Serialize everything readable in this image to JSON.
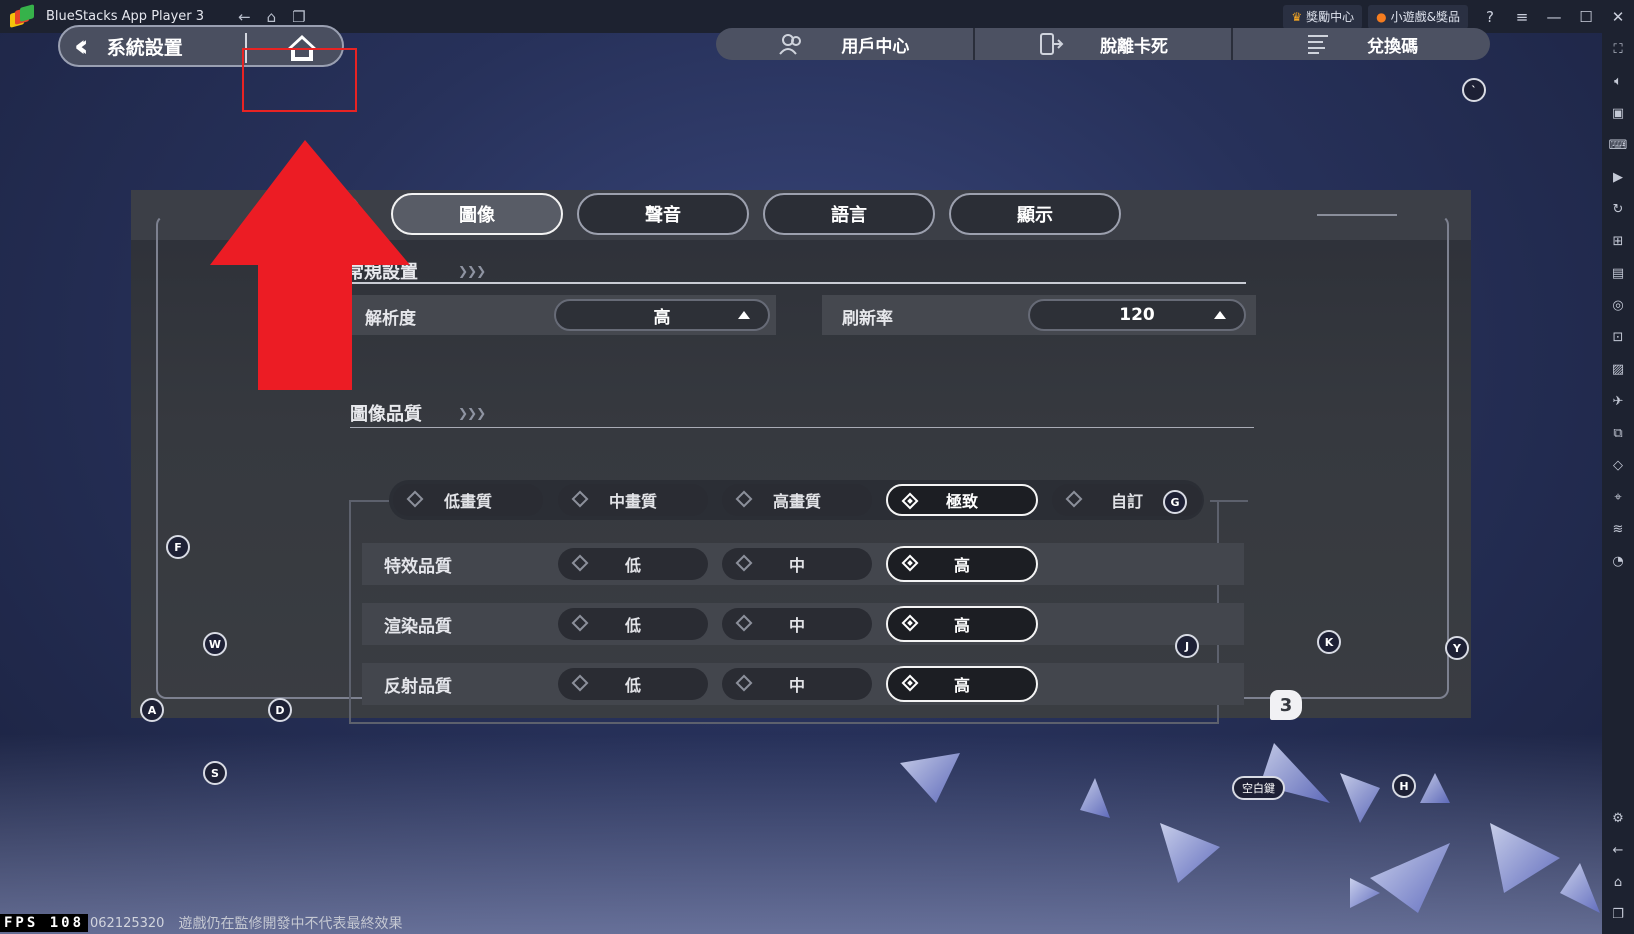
{
  "titlebar": {
    "app_title": "BlueStacks App Player 3",
    "reward_label": "獎勵中心",
    "minigame_label": "小遊戲&獎品",
    "icons": [
      "back-icon",
      "home-icon",
      "windows-icon",
      "help-icon",
      "menu-icon",
      "minimize-icon",
      "maximize-icon",
      "close-icon"
    ]
  },
  "header": {
    "back_label": "系統設置",
    "menu": [
      {
        "label": "用戶中心",
        "icon": "users-icon"
      },
      {
        "label": "脫離卡死",
        "icon": "phone-exit-icon"
      },
      {
        "label": "兌換碼",
        "icon": "redeem-icon"
      }
    ]
  },
  "tabs": [
    {
      "label": "圖像",
      "active": true
    },
    {
      "label": "聲音",
      "active": false
    },
    {
      "label": "語言",
      "active": false
    },
    {
      "label": "顯示",
      "active": false
    }
  ],
  "general": {
    "title": "常規設置",
    "resolution_label": "解析度",
    "resolution_value": "高",
    "refresh_label": "刷新率",
    "refresh_value": "120"
  },
  "quality": {
    "title": "圖像品質",
    "presets": [
      "低畫質",
      "中畫質",
      "高畫質",
      "極致",
      "自訂"
    ],
    "selected_preset": "極致",
    "rows": [
      {
        "label": "特效品質",
        "options": [
          "低",
          "中",
          "高"
        ],
        "selected": "高"
      },
      {
        "label": "渲染品質",
        "options": [
          "低",
          "中",
          "高"
        ],
        "selected": "高"
      },
      {
        "label": "反射品質",
        "options": [
          "低",
          "中",
          "高"
        ],
        "selected": "高"
      }
    ]
  },
  "keys": {
    "F": "F",
    "W": "W",
    "A": "A",
    "D": "D",
    "S": "S",
    "G": "G",
    "J": "J",
    "K": "K",
    "Y": "Y",
    "H": "H",
    "backtick": "`",
    "space": "空白鍵"
  },
  "badge": "3",
  "footer": {
    "fps_label": "FPS 108",
    "build": "062125320",
    "notice": "遊戲仍在監修開發中不代表最終效果"
  },
  "colors": {
    "highlight": "#e82323",
    "arrow": "#ec1c24",
    "chrome": "#1d2230"
  }
}
